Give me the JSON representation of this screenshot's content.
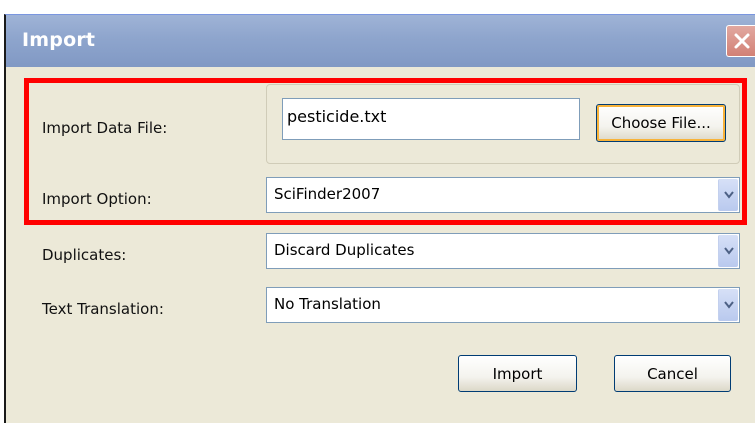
{
  "window": {
    "title": "Import"
  },
  "form": {
    "data_file": {
      "label": "Import Data File:",
      "value": "pesticide.txt",
      "choose_label": "Choose File..."
    },
    "import_option": {
      "label": "Import Option:",
      "selected": "SciFinder2007"
    },
    "duplicates": {
      "label": "Duplicates:",
      "selected": "Discard Duplicates"
    },
    "text_translation": {
      "label": "Text Translation:",
      "selected": "No Translation"
    }
  },
  "buttons": {
    "import_label": "Import",
    "cancel_label": "Cancel"
  },
  "icons": {
    "close": "close-icon",
    "dropdown": "chevron-down-icon"
  },
  "colors": {
    "titlebar": "#8ea5cd",
    "dialog_bg": "#ece9d8",
    "highlight": "#ff0000",
    "close_button": "#d28176"
  }
}
